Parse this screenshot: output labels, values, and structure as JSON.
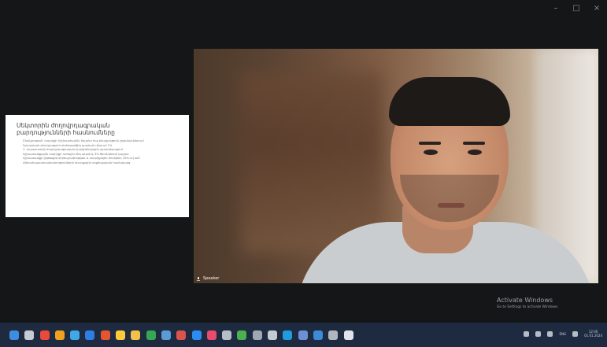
{
  "window": {
    "controls": {
      "minimize": "–",
      "maximize": "□",
      "close": "×"
    }
  },
  "slide": {
    "title": "Սեկտորին ժողովրդագրական բարդությունների հասնումները",
    "bullets": [
      "Բնակչության՝ տարիքի (Աշխարհային) ինչպես հայ բնակչության շրջանակներում",
      "Գյուղական բնակչություն դեմոգրաֆիկ դրական միտում 1%",
      "1. Հայաստանի ժողովրդագրական իրավիճակային պատկերացում",
      "Աշխատանքային տարիքի ուժային մեկ ակտիվ: 3% ծնունդների կաշառ",
      "Աշխատանքի ընթացիկ օրինաչափության և տարիքային մոդելներ 10%-ով աճ: Անհամապատասխանությունների մուտքային սոցիալական համակարգ"
    ]
  },
  "video": {
    "participant_name": "Speaker"
  },
  "watermark": {
    "title": "Activate Windows",
    "subtitle": "Go to Settings to activate Windows."
  },
  "taskbar": {
    "icons": [
      {
        "name": "windows-start-icon",
        "color": "#3d8ee0"
      },
      {
        "name": "search-icon",
        "color": "#c7ccd4"
      },
      {
        "name": "app-icon-1",
        "color": "#e84a3c"
      },
      {
        "name": "app-icon-2",
        "color": "#f0a020"
      },
      {
        "name": "app-icon-3",
        "color": "#3fa9e8"
      },
      {
        "name": "app-icon-4",
        "color": "#2f7de0"
      },
      {
        "name": "app-icon-5",
        "color": "#e6552e"
      },
      {
        "name": "app-icon-6",
        "color": "#ffc83d"
      },
      {
        "name": "app-icon-7",
        "color": "#f5c04a"
      },
      {
        "name": "app-icon-8",
        "color": "#34a853"
      },
      {
        "name": "app-icon-9",
        "color": "#5b9bd5"
      },
      {
        "name": "app-icon-10",
        "color": "#d9534f"
      },
      {
        "name": "app-icon-11",
        "color": "#2d8cf0"
      },
      {
        "name": "app-icon-12",
        "color": "#e94b6d"
      },
      {
        "name": "app-icon-13",
        "color": "#b8bec8"
      },
      {
        "name": "app-icon-14",
        "color": "#4caf50"
      },
      {
        "name": "app-icon-15",
        "color": "#9fa7b3"
      },
      {
        "name": "app-icon-16",
        "color": "#c4cad4"
      },
      {
        "name": "app-icon-17",
        "color": "#1f9bde"
      },
      {
        "name": "app-icon-18",
        "color": "#6c8fd6"
      },
      {
        "name": "app-icon-19",
        "color": "#3c8ad8"
      },
      {
        "name": "app-icon-20",
        "color": "#b0b6c0"
      },
      {
        "name": "app-icon-21",
        "color": "#e0e4ea"
      }
    ],
    "tray": {
      "lang": "ENG",
      "time": "12:00",
      "date": "01.01.2024"
    }
  }
}
